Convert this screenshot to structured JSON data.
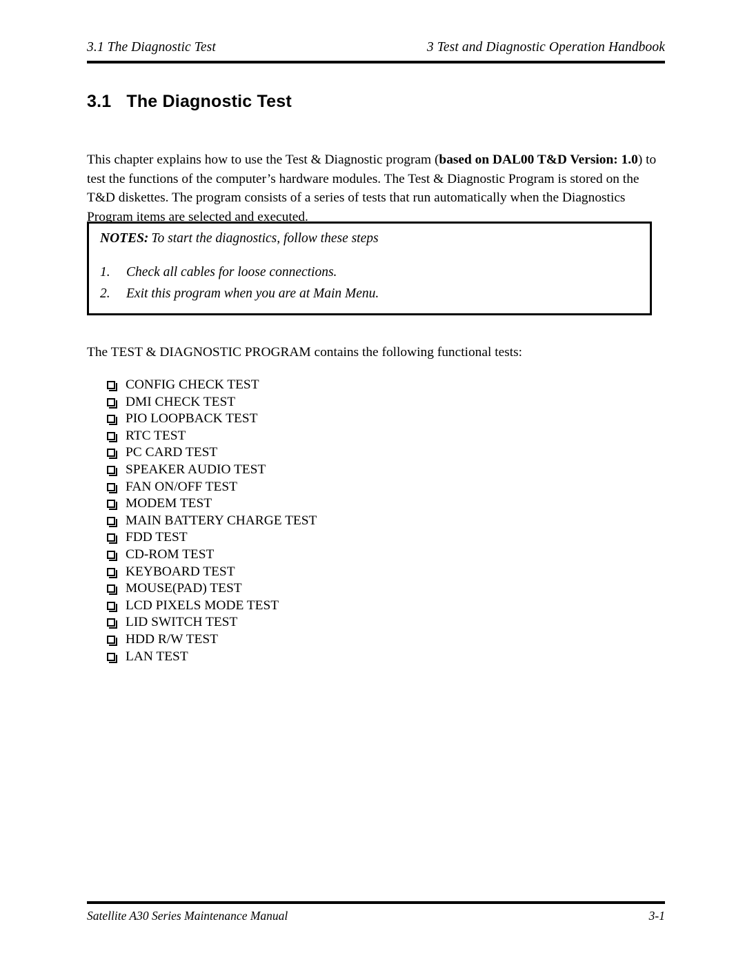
{
  "header": {
    "left": "3.1  The Diagnostic Test",
    "right": "3  Test and Diagnostic Operation Handbook"
  },
  "heading": {
    "number": "3.1",
    "title": "The Diagnostic Test"
  },
  "intro": {
    "part1": "This chapter explains how to use the Test & Diagnostic program (",
    "bold": "based on DAL00 T&D Version: 1.0",
    "part2": ") to test the functions of the computer’s hardware modules.  The Test & Diagnostic Program is stored on the T&D diskettes. The program consists of a series of tests that run automatically when the Diagnostics Program items are selected and executed."
  },
  "notes": {
    "label": "NOTES:",
    "title": "To start the diagnostics, follow these steps",
    "items": [
      {
        "num": "1.",
        "text": "Check all cables for loose connections."
      },
      {
        "num": "2.",
        "text": "Exit this program when you are at Main Menu."
      }
    ]
  },
  "lead_in": "The TEST & DIAGNOSTIC PROGRAM contains the following functional tests:",
  "tests": [
    "CONFIG CHECK TEST",
    "DMI CHECK TEST",
    "PIO LOOPBACK TEST",
    "RTC TEST",
    "PC CARD TEST",
    "SPEAKER AUDIO TEST",
    "FAN ON/OFF TEST",
    "MODEM TEST",
    "MAIN BATTERY CHARGE TEST",
    "FDD TEST",
    "CD-ROM TEST",
    "KEYBOARD TEST",
    "MOUSE(PAD) TEST",
    "LCD PIXELS MODE TEST",
    "LID SWITCH TEST",
    "HDD R/W TEST",
    "LAN TEST"
  ],
  "footer": {
    "left": "Satellite A30 Series Maintenance Manual",
    "right": "3-1"
  },
  "colors": {
    "text": "#000000",
    "page_background": "#ffffff",
    "rule": "#000000"
  }
}
